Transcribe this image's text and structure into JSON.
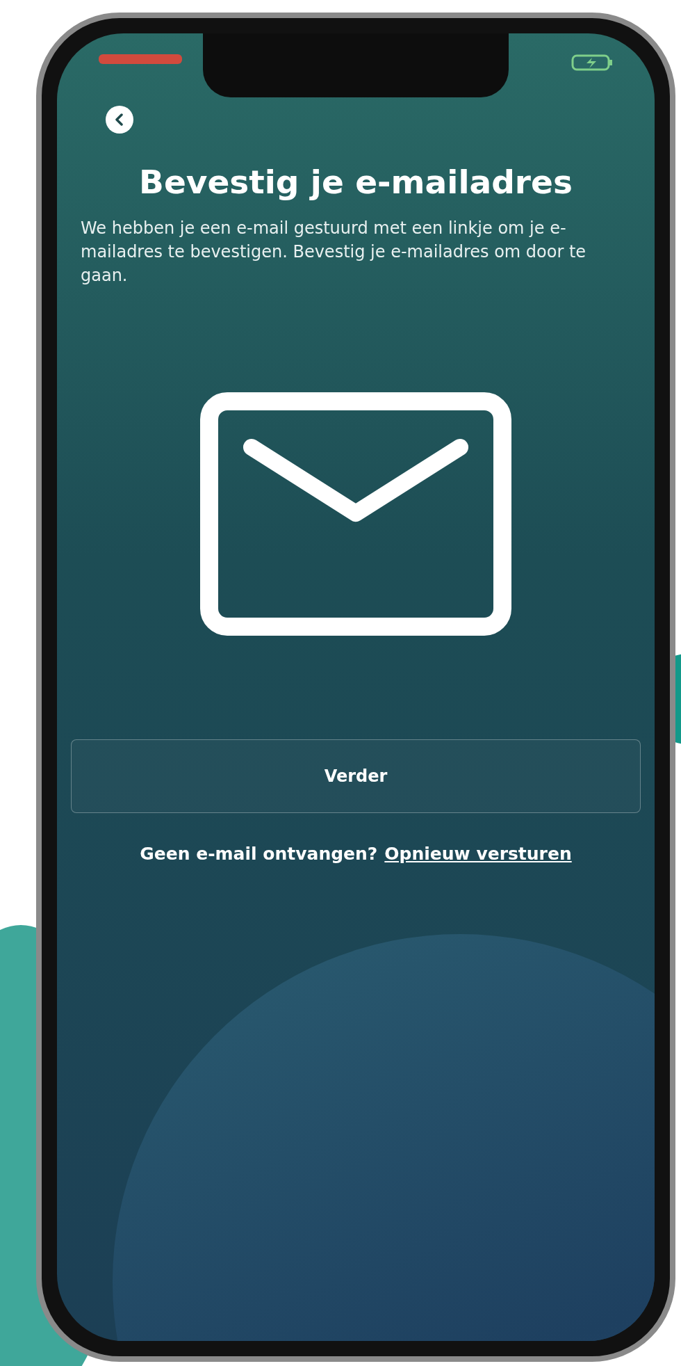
{
  "title": "Bevestig je e-mailadres",
  "message": "We hebben je een e-mail gestuurd met een linkje om je e-mailadres te bevestigen. Bevestig je e-mailadres om door te gaan.",
  "continue_button": "Verder",
  "resend_prompt": "Geen e-mail ontvangen?",
  "resend_link": "Opnieuw versturen"
}
